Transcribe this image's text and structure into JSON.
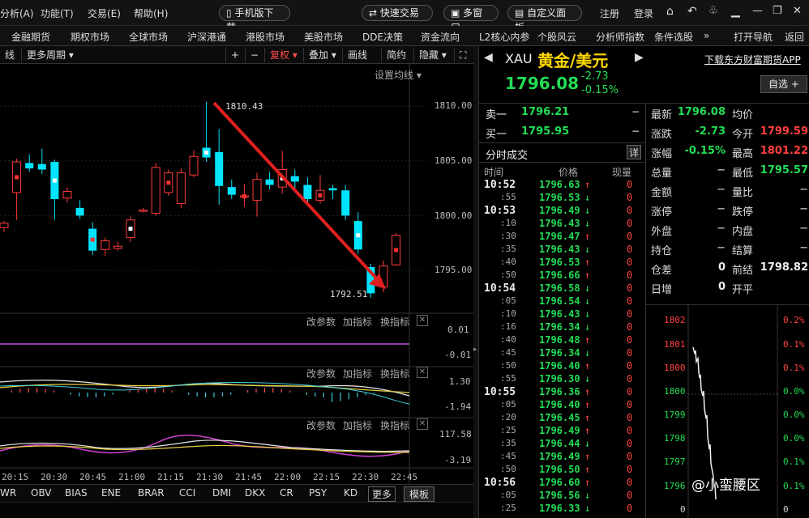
{
  "menubar": {
    "items": [
      "分析(A)",
      "功能(T)",
      "交易(E)",
      "帮助(H)"
    ],
    "mobile_download": "手机版下载",
    "quick_trade": "快速交易",
    "multi_window": "多窗口",
    "custom_panel": "自定义面板",
    "register": "注册",
    "login": "登录"
  },
  "navbar": {
    "items": [
      "金融期货",
      "期权市场",
      "全球市场",
      "沪深港通",
      "港股市场",
      "美股市场",
      "DDE决策",
      "资金流向",
      "L2核心内参",
      "个股风云",
      "分析师指数",
      "条件选股"
    ],
    "more": "»",
    "open_nav": "打开导航",
    "back": "返回"
  },
  "toolbar": {
    "left": "线",
    "more_period": "更多周期",
    "plus": "+",
    "minus": "−",
    "fuquan": "复权",
    "overlay": "叠加",
    "draw": "画线",
    "simple": "简约",
    "hide": "隐藏",
    "set_ma": "设置均线"
  },
  "chart": {
    "price_ticks": [
      "1810.00",
      "1805.00",
      "1800.00",
      "1795.00"
    ],
    "high_label": "1810.43",
    "low_label": "1792.51",
    "time_ticks": [
      "20:15",
      "20:30",
      "20:45",
      "21:00",
      "21:15",
      "21:30",
      "21:45",
      "22:00",
      "22:15",
      "22:30",
      "22:45"
    ],
    "ind1_ticks": [
      "0.01",
      "-0.01"
    ],
    "ind2_ticks": [
      "1.30",
      "-1.94"
    ],
    "ind3_ticks": [
      "117.58",
      "-3.19"
    ],
    "ind_buttons": [
      "改参数",
      "加指标",
      "换指标"
    ]
  },
  "chart_data": {
    "type": "candlestick",
    "ylim": [
      1791,
      1812
    ],
    "candles": [
      {
        "o": 1798.9,
        "c": 1799.3,
        "h": 1799.5,
        "l": 1798.5
      },
      {
        "o": 1802.1,
        "c": 1804.9,
        "h": 1805.2,
        "l": 1799.6
      },
      {
        "o": 1804.8,
        "c": 1804.3,
        "h": 1805.6,
        "l": 1804.0
      },
      {
        "o": 1804.7,
        "c": 1804.2,
        "h": 1806.1,
        "l": 1803.8
      },
      {
        "o": 1804.9,
        "c": 1801.5,
        "h": 1805.1,
        "l": 1799.6
      },
      {
        "o": 1801.6,
        "c": 1802.2,
        "h": 1802.6,
        "l": 1801.2
      },
      {
        "o": 1800.7,
        "c": 1800.0,
        "h": 1801.4,
        "l": 1799.7
      },
      {
        "o": 1798.8,
        "c": 1796.8,
        "h": 1799.4,
        "l": 1796.4
      },
      {
        "o": 1796.9,
        "c": 1797.7,
        "h": 1798.0,
        "l": 1796.3
      },
      {
        "o": 1797.0,
        "c": 1797.2,
        "h": 1797.6,
        "l": 1796.8
      },
      {
        "o": 1798.0,
        "c": 1799.6,
        "h": 1799.9,
        "l": 1797.6
      },
      {
        "o": 1800.5,
        "c": 1800.5,
        "h": 1800.7,
        "l": 1800.3
      },
      {
        "o": 1800.2,
        "c": 1804.4,
        "h": 1804.8,
        "l": 1800.0
      },
      {
        "o": 1802.1,
        "c": 1803.9,
        "h": 1804.2,
        "l": 1801.8
      },
      {
        "o": 1801.1,
        "c": 1803.9,
        "h": 1804.3,
        "l": 1800.7
      },
      {
        "o": 1803.7,
        "c": 1805.4,
        "h": 1806.0,
        "l": 1803.5
      },
      {
        "o": 1806.2,
        "c": 1805.3,
        "h": 1810.4,
        "l": 1804.9
      },
      {
        "o": 1805.8,
        "c": 1802.7,
        "h": 1807.9,
        "l": 1801.0
      },
      {
        "o": 1802.6,
        "c": 1801.9,
        "h": 1803.3,
        "l": 1801.5
      },
      {
        "o": 1801.7,
        "c": 1801.8,
        "h": 1802.9,
        "l": 1800.8
      },
      {
        "o": 1801.4,
        "c": 1803.3,
        "h": 1803.9,
        "l": 1799.9
      },
      {
        "o": 1803.3,
        "c": 1802.8,
        "h": 1804.0,
        "l": 1802.4
      },
      {
        "o": 1802.6,
        "c": 1804.2,
        "h": 1805.9,
        "l": 1802.0
      },
      {
        "o": 1803.6,
        "c": 1803.1,
        "h": 1804.2,
        "l": 1802.4
      },
      {
        "o": 1802.8,
        "c": 1801.5,
        "h": 1803.5,
        "l": 1800.9
      },
      {
        "o": 1801.4,
        "c": 1802.3,
        "h": 1803.7,
        "l": 1801.1
      },
      {
        "o": 1802.5,
        "c": 1802.3,
        "h": 1802.8,
        "l": 1801.5
      },
      {
        "o": 1802.3,
        "c": 1800.0,
        "h": 1802.8,
        "l": 1799.6
      },
      {
        "o": 1799.5,
        "c": 1796.9,
        "h": 1800.3,
        "l": 1796.5
      },
      {
        "o": 1795.3,
        "c": 1792.9,
        "h": 1795.6,
        "l": 1792.5
      },
      {
        "o": 1793.5,
        "c": 1795.4,
        "h": 1795.9,
        "l": 1793.0
      },
      {
        "o": 1795.5,
        "c": 1798.2,
        "h": 1798.4,
        "l": 1795.4
      }
    ]
  },
  "quote": {
    "symbol": "XAU",
    "name": "黄金/美元",
    "price": "1796.08",
    "change": "-2.73",
    "change_pct": "-0.15%",
    "download_app": "下载东方财富期货APP",
    "watch_btn": "自选",
    "sell1_label": "卖一",
    "sell1_price": "1796.21",
    "sell1_vol": "−",
    "buy1_label": "买一",
    "buy1_price": "1795.95",
    "buy1_vol": "−",
    "trades_title": "分时成交",
    "detail_btn": "详",
    "col_time": "时间",
    "col_price": "价格",
    "col_vol": "现量"
  },
  "trades": [
    {
      "t": "10:52",
      "p": "1796.63",
      "d": "up",
      "v": "0"
    },
    {
      "t": ":55",
      "p": "1796.53",
      "d": "down",
      "v": "0"
    },
    {
      "t": "10:53",
      "p": "1796.49",
      "d": "down",
      "v": "0"
    },
    {
      "t": ":10",
      "p": "1796.43",
      "d": "down",
      "v": "0"
    },
    {
      "t": ":30",
      "p": "1796.47",
      "d": "up",
      "v": "0"
    },
    {
      "t": ":35",
      "p": "1796.43",
      "d": "down",
      "v": "0"
    },
    {
      "t": ":40",
      "p": "1796.53",
      "d": "up",
      "v": "0"
    },
    {
      "t": ":50",
      "p": "1796.66",
      "d": "up",
      "v": "0"
    },
    {
      "t": "10:54",
      "p": "1796.58",
      "d": "down",
      "v": "0"
    },
    {
      "t": ":05",
      "p": "1796.54",
      "d": "down",
      "v": "0"
    },
    {
      "t": ":10",
      "p": "1796.43",
      "d": "down",
      "v": "0"
    },
    {
      "t": ":16",
      "p": "1796.34",
      "d": "down",
      "v": "0"
    },
    {
      "t": ":40",
      "p": "1796.48",
      "d": "up",
      "v": "0"
    },
    {
      "t": ":45",
      "p": "1796.34",
      "d": "down",
      "v": "0"
    },
    {
      "t": ":50",
      "p": "1796.40",
      "d": "up",
      "v": "0"
    },
    {
      "t": ":55",
      "p": "1796.30",
      "d": "down",
      "v": "0"
    },
    {
      "t": "10:55",
      "p": "1796.36",
      "d": "up",
      "v": "0"
    },
    {
      "t": ":05",
      "p": "1796.40",
      "d": "up",
      "v": "0"
    },
    {
      "t": ":20",
      "p": "1796.45",
      "d": "up",
      "v": "0"
    },
    {
      "t": ":25",
      "p": "1796.49",
      "d": "up",
      "v": "0"
    },
    {
      "t": ":35",
      "p": "1796.44",
      "d": "down",
      "v": "0"
    },
    {
      "t": ":45",
      "p": "1796.49",
      "d": "up",
      "v": "0"
    },
    {
      "t": ":50",
      "p": "1796.50",
      "d": "up",
      "v": "0"
    },
    {
      "t": "10:56",
      "p": "1796.60",
      "d": "up",
      "v": "0"
    },
    {
      "t": ":05",
      "p": "1796.56",
      "d": "down",
      "v": "0"
    },
    {
      "t": ":25",
      "p": "1796.33",
      "d": "down",
      "v": "0"
    }
  ],
  "stats": {
    "latest_l": "最新",
    "latest_v": "1796.08",
    "avg_l": "均价",
    "avg_v": "",
    "chg_l": "涨跌",
    "chg_v": "-2.73",
    "open_l": "今开",
    "open_v": "1799.59",
    "pct_l": "涨幅",
    "pct_v": "-0.15%",
    "high_l": "最高",
    "high_v": "1801.22",
    "vol_l": "总量",
    "vol_v": "−",
    "low_l": "最低",
    "low_v": "1795.57",
    "amt_l": "金额",
    "amt_v": "−",
    "ratio_l": "量比",
    "ratio_v": "−",
    "lim_up_l": "涨停",
    "lim_up_v": "−",
    "lim_dn_l": "跌停",
    "lim_dn_v": "−",
    "outer_l": "外盘",
    "outer_v": "−",
    "inner_l": "内盘",
    "inner_v": "−",
    "pos_l": "持仓",
    "pos_v": "−",
    "settle_l": "结算",
    "settle_v": "−",
    "oi_l": "仓差",
    "oi_v": "0",
    "prev_l": "前结",
    "prev_v": "1798.82",
    "daily_l": "日增",
    "daily_v": "0",
    "flat_l": "开平",
    "flat_v": ""
  },
  "mini": {
    "left_ticks": [
      "1802",
      "1801",
      "1800",
      "1800",
      "1799",
      "1798",
      "1797",
      "1796",
      "0"
    ],
    "right_ticks": [
      "0.2%",
      "0.1%",
      "0.1%",
      "0.0%",
      "0.0%",
      "0.0%",
      "0.1%",
      "0.1%",
      "0"
    ]
  },
  "tabs": [
    "WR",
    "OBV",
    "BIAS",
    "ENE",
    "BRAR",
    "CCI",
    "DMI",
    "DKX",
    "CR",
    "PSY",
    "KD",
    "更多",
    "模板"
  ],
  "watermark": "@小蛮腰区",
  "colors": {
    "up": "#ff3b3b",
    "down": "#00e5ff",
    "green": "#22dd55",
    "arrow": "#e02020"
  }
}
